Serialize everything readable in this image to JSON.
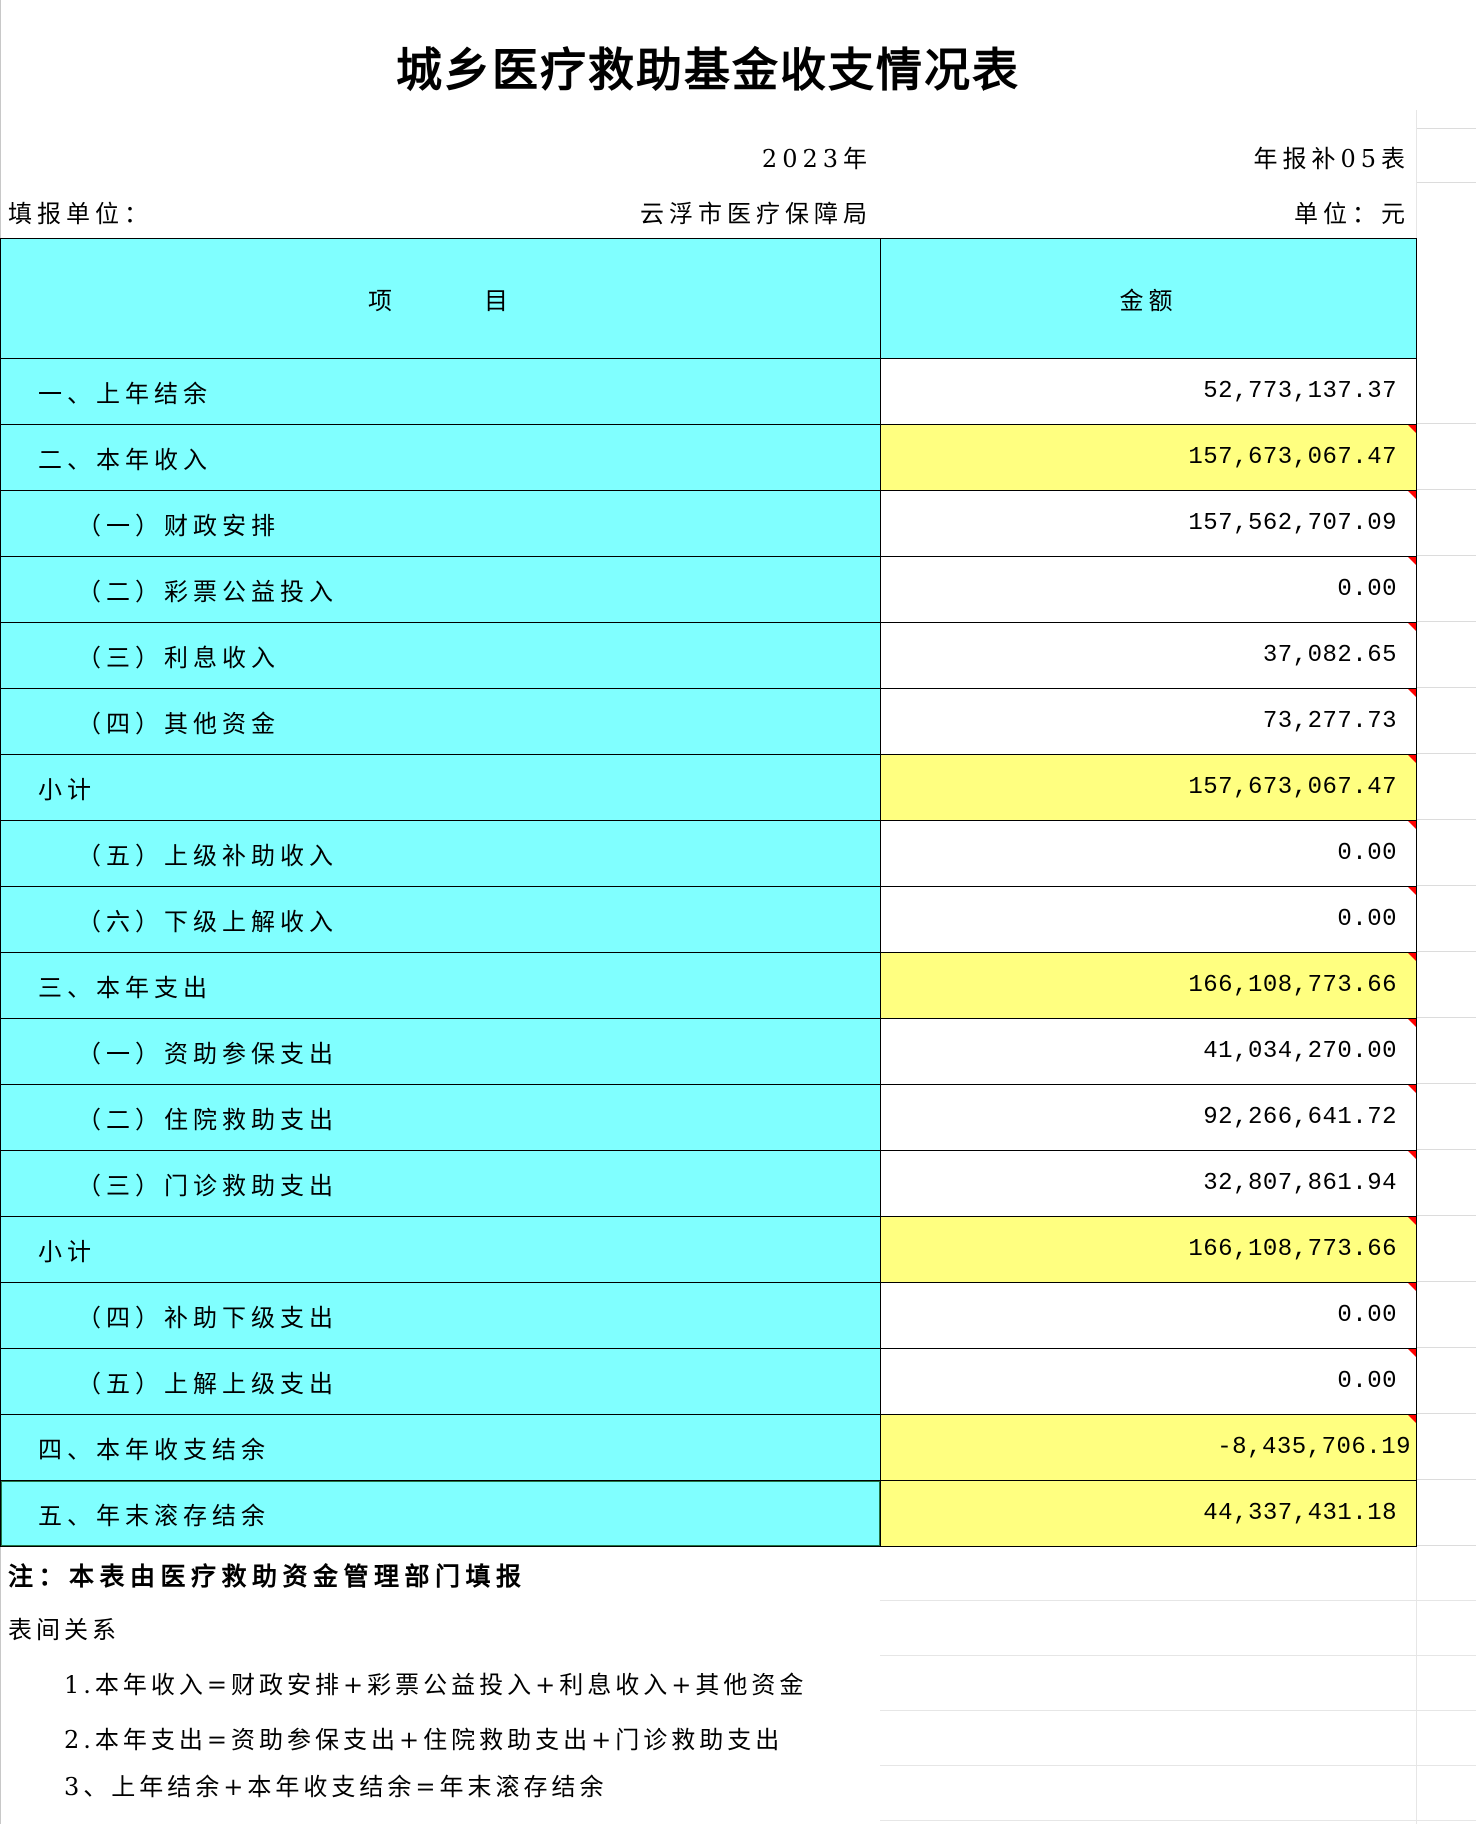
{
  "title": "城乡医疗救助基金收支情况表",
  "meta": {
    "year": "2023年",
    "form_code": "年报补05表",
    "unit_label": "填报单位：",
    "unit_name": "云浮市医疗保障局",
    "currency_unit": "单位：元"
  },
  "table": {
    "headers": {
      "item": "项　　　目",
      "amount": "金额"
    },
    "rows": [
      {
        "item": "一、上年结余",
        "amount": "52,773,137.37"
      },
      {
        "item": "二、本年收入",
        "amount": "157,673,067.47"
      },
      {
        "item": "（一）财政安排",
        "amount": "157,562,707.09"
      },
      {
        "item": "（二）彩票公益投入",
        "amount": "0.00"
      },
      {
        "item": "（三）利息收入",
        "amount": "37,082.65"
      },
      {
        "item": "（四）其他资金",
        "amount": "73,277.73"
      },
      {
        "item": "小计",
        "amount": "157,673,067.47"
      },
      {
        "item": "（五）上级补助收入",
        "amount": "0.00"
      },
      {
        "item": "（六）下级上解收入",
        "amount": "0.00"
      },
      {
        "item": "三、本年支出",
        "amount": "166,108,773.66"
      },
      {
        "item": "（一）资助参保支出",
        "amount": "41,034,270.00"
      },
      {
        "item": "（二）住院救助支出",
        "amount": "92,266,641.72"
      },
      {
        "item": "（三）门诊救助支出",
        "amount": "32,807,861.94"
      },
      {
        "item": "小计",
        "amount": "166,108,773.66"
      },
      {
        "item": "（四）补助下级支出",
        "amount": "0.00"
      },
      {
        "item": "（五）上解上级支出",
        "amount": "0.00"
      },
      {
        "item": "四、本年收支结余",
        "amount": "-8,435,706.19"
      },
      {
        "item": "五、年末滚存结余",
        "amount": "44,337,431.18"
      }
    ]
  },
  "notes": {
    "remark": "注：本表由医疗救助资金管理部门填报",
    "relations_title": "表间关系",
    "relations": [
      "1.本年收入=财政安排+彩票公益投入+利息收入+其他资金",
      "2.本年支出=资助参保支出+住院救助支出+门诊救助支出",
      "3、上年结余+本年收支结余=年末滚存结余"
    ]
  },
  "colors": {
    "header_bg": "#80FFFF",
    "total_bg": "#FFFF80",
    "border": "#000000",
    "comment_marker": "#FF0000",
    "selection": "#217346"
  }
}
